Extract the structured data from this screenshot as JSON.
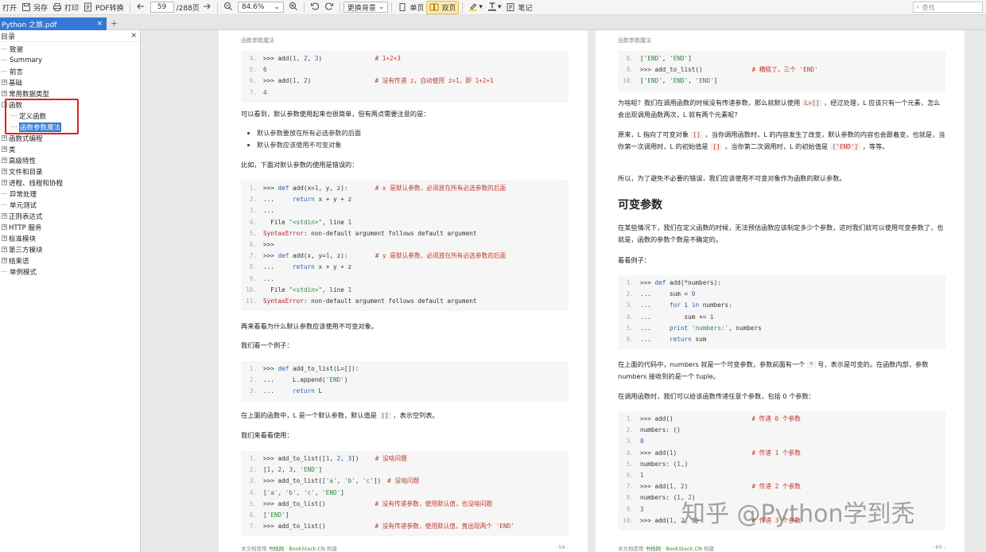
{
  "toolbar": {
    "open": "打开",
    "save_as": "另存",
    "print": "打印",
    "pdf_convert": "PDF转换",
    "page_current": "59",
    "page_total": "/288页",
    "zoom": "84.6%",
    "bg_label": "更换背景",
    "single": "单页",
    "double": "双页",
    "notes": "笔记",
    "search_placeholder": "查找"
  },
  "tab": {
    "title": "Python 之旅.pdf",
    "close": "×",
    "new": "+"
  },
  "sidebar": {
    "title": "目录",
    "close": "×",
    "items": [
      {
        "label": "致谢",
        "expand": ""
      },
      {
        "label": "Summary",
        "expand": ""
      },
      {
        "label": "前言",
        "expand": ""
      },
      {
        "label": "基础",
        "expand": "+"
      },
      {
        "label": "常用数据类型",
        "expand": "+"
      },
      {
        "label": "函数",
        "expand": "-"
      },
      {
        "label": "定义函数",
        "expand": ""
      },
      {
        "label": "函数参数魔法",
        "expand": ""
      },
      {
        "label": "函数式编程",
        "expand": "+"
      },
      {
        "label": "类",
        "expand": "+"
      },
      {
        "label": "高级特性",
        "expand": "+"
      },
      {
        "label": "文件和目录",
        "expand": "+"
      },
      {
        "label": "进程、线程和协程",
        "expand": "+"
      },
      {
        "label": "异常处理",
        "expand": ""
      },
      {
        "label": "单元测试",
        "expand": ""
      },
      {
        "label": "正则表达式",
        "expand": "+"
      },
      {
        "label": "HTTP 服务",
        "expand": "+"
      },
      {
        "label": "标准模块",
        "expand": "+"
      },
      {
        "label": "第三方模块",
        "expand": "+"
      },
      {
        "label": "结束语",
        "expand": "+"
      },
      {
        "label": "单例模式",
        "expand": ""
      }
    ]
  },
  "page1": {
    "header": "函数参数魔法",
    "code1": [
      {
        "n": "4.",
        "a": ">>> add(1, 2, 3)",
        "b": "# 1+2+3"
      },
      {
        "n": "5.",
        "a": "6",
        "b": ""
      },
      {
        "n": "6.",
        "a": ">>> add(1, 2)",
        "b": "# 没有传递 z，自动使用 z=1，即 1+2+1"
      },
      {
        "n": "7.",
        "a": "4",
        "b": ""
      }
    ],
    "t1": "可以看到，默认参数使用起来也很简单，但有两点需要注意的是：",
    "bullets": [
      "默认参数要放在所有必选参数的后面",
      "默认参数应该使用不可变对象"
    ],
    "t2": "比如，下面对默认参数的使用是错误的：",
    "code2": [
      {
        "n": "1.",
        "a": ">>> def add(x=1, y, z):",
        "b": "# x 是默认参数，必须放在所有必选参数的后面"
      },
      {
        "n": "2.",
        "a": "...     return x + y + z",
        "b": ""
      },
      {
        "n": "3.",
        "a": "...",
        "b": ""
      },
      {
        "n": "4.",
        "a": "  File \"<stdin>\", line 1",
        "b": ""
      },
      {
        "n": "5.",
        "a": "SyntaxError: non-default argument follows default argument",
        "b": ""
      },
      {
        "n": "6.",
        "a": ">>>",
        "b": ""
      },
      {
        "n": "7.",
        "a": ">>> def add(x, y=1, z):",
        "b": "# y 是默认参数，必须放在所有必选参数的后面"
      },
      {
        "n": "8.",
        "a": "...     return x + y + z",
        "b": ""
      },
      {
        "n": "9.",
        "a": "...",
        "b": ""
      },
      {
        "n": "10.",
        "a": "  File \"<stdin>\", line 1",
        "b": ""
      },
      {
        "n": "11.",
        "a": "SyntaxError: non-default argument follows default argument",
        "b": ""
      }
    ],
    "t3": "再来看看为什么默认参数应该使用不可变对象。",
    "t4": "我们看一个例子：",
    "code3": [
      {
        "n": "1.",
        "a": ">>> def add_to_list(L=[]):",
        "b": ""
      },
      {
        "n": "2.",
        "a": "...     L.append('END')",
        "b": ""
      },
      {
        "n": "3.",
        "a": "...     return L",
        "b": ""
      }
    ],
    "t5a": "在上面的函数中，L 是一个默认参数，默认值是",
    "t5code": "[]",
    "t5b": "，表示空列表。",
    "t6": "我们来看看使用：",
    "code4": [
      {
        "n": "1.",
        "a": ">>> add_to_list([1, 2, 3])",
        "b": "# 没啥问题"
      },
      {
        "n": "2.",
        "a": "[1, 2, 3, 'END']",
        "b": ""
      },
      {
        "n": "3.",
        "a": ">>> add_to_list(['a', 'b', 'c'])",
        "b": "# 没啥问题"
      },
      {
        "n": "4.",
        "a": "['a', 'b', 'c', 'END']",
        "b": ""
      },
      {
        "n": "5.",
        "a": ">>> add_to_list()",
        "b": "# 没有传递参数，使用默认值，也没啥问题"
      },
      {
        "n": "6.",
        "a": "['END']",
        "b": ""
      },
      {
        "n": "7.",
        "a": ">>> add_to_list()",
        "b": "# 没有传递参数，使用默认值，竟出现两个 'END'"
      }
    ],
    "footer_left": "本文档使用",
    "footer_site": "书栈网 · BookStack.CN",
    "footer_build": "构建",
    "footer_page": "- 59 -"
  },
  "page2": {
    "header": "函数参数魔法",
    "code1": [
      {
        "n": "8.",
        "a": "['END', 'END']",
        "b": ""
      },
      {
        "n": "9.",
        "a": ">>> add_to_list()",
        "b": "# 糟糕了，三个 'END'"
      },
      {
        "n": "10.",
        "a": "['END', 'END', 'END']",
        "b": ""
      }
    ],
    "t1a": "为啥呢？我们在调用函数的时候没有传递参数，那么就默认使用",
    "t1code": "L=[]",
    "t1b": "，经过处理，L 应该只有一个元素，怎么会出现调用函数两次，L 就有两个元素呢？",
    "t2a": "原来，L 指向了可变对象",
    "t2code1": "[]",
    "t2b": "，当你调用函数时，L 的内容发生了改变，默认参数的内容也会跟着变，也就是，当你第一次调用时，L 的初始值是",
    "t2code2": "[]",
    "t2c": "，当你第二次调用时，L 的初始值是",
    "t2code3": "['END']",
    "t2d": "，等等。",
    "t3": "所以，为了避免不必要的错误，我们应该使用不可变对象作为函数的默认参数。",
    "h2": "可变参数",
    "t4": "在某些情况下，我们在定义函数的时候，无法预估函数应该制定多少个参数，这时我们就可以使用可变参数了，也就是，函数的参数个数是不确定的。",
    "t5": "看看例子：",
    "code2": [
      {
        "n": "1.",
        "a": ">>> def add(*numbers):",
        "b": ""
      },
      {
        "n": "2.",
        "a": "...     sum = 0",
        "b": ""
      },
      {
        "n": "3.",
        "a": "...     for i in numbers:",
        "b": ""
      },
      {
        "n": "4.",
        "a": "...         sum += i",
        "b": ""
      },
      {
        "n": "5.",
        "a": "...     print 'numbers:', numbers",
        "b": ""
      },
      {
        "n": "6.",
        "a": "...     return sum",
        "b": ""
      }
    ],
    "t6a": "在上面的代码中，numbers 就是一个可变参数，参数前面有一个",
    "t6code": "*",
    "t6b": "号，表示是可变的。在函数内部，参数 numbers 接收到的是一个 tuple。",
    "t7": "在调用函数时，我们可以给该函数传递任意个参数，包括 0 个参数：",
    "code3": [
      {
        "n": "1.",
        "a": ">>> add()",
        "b": "# 传递 0 个参数"
      },
      {
        "n": "2.",
        "a": "numbers: ()",
        "b": ""
      },
      {
        "n": "3.",
        "a": "0",
        "b": ""
      },
      {
        "n": "4.",
        "a": ">>> add(1)",
        "b": "# 传递 1 个参数"
      },
      {
        "n": "5.",
        "a": "numbers: (1,)",
        "b": ""
      },
      {
        "n": "6.",
        "a": "1",
        "b": ""
      },
      {
        "n": "7.",
        "a": ">>> add(1, 2)",
        "b": "# 传递 2 个参数"
      },
      {
        "n": "8.",
        "a": "numbers: (1, 2)",
        "b": ""
      },
      {
        "n": "9.",
        "a": "3",
        "b": ""
      },
      {
        "n": "10.",
        "a": ">>> add(1, 2, 3)",
        "b": "# 传递 3 个参数"
      }
    ],
    "footer_left": "本文档使用",
    "footer_site": "书栈网 · BookStack.CN",
    "footer_build": "构建",
    "footer_page": "- 60 -"
  },
  "watermark": "知乎 @Python学到秃"
}
